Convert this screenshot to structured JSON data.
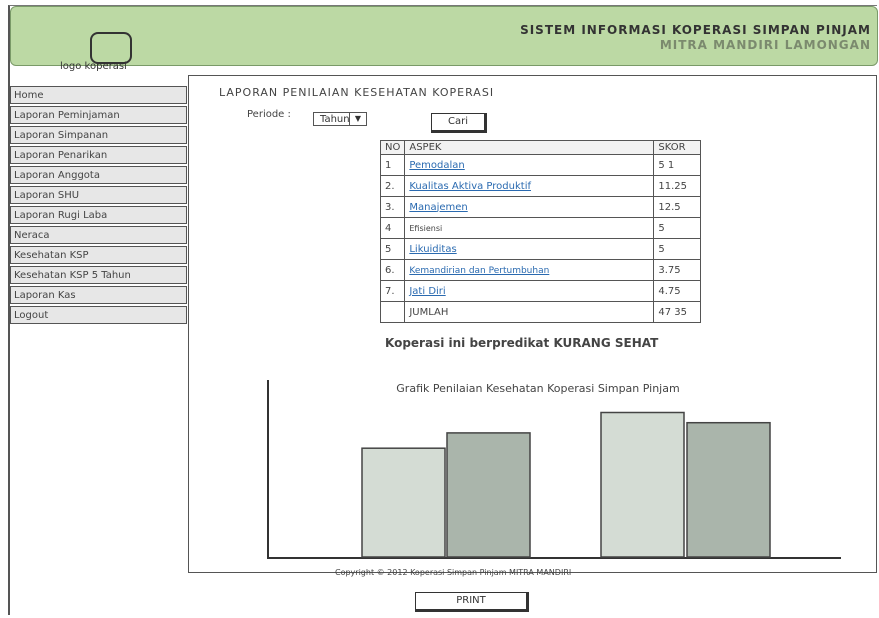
{
  "header": {
    "logo_label": "logo koperasi",
    "title": "SISTEM INFORMASI KOPERASI SIMPAN PINJAM",
    "subtitle": "MITRA MANDIRI LAMONGAN"
  },
  "sidebar": {
    "items": [
      {
        "label": "Home"
      },
      {
        "label": "Laporan Peminjaman"
      },
      {
        "label": "Laporan Simpanan"
      },
      {
        "label": "Laporan Penarikan"
      },
      {
        "label": "Laporan Anggota"
      },
      {
        "label": "Laporan SHU"
      },
      {
        "label": "Laporan Rugi Laba"
      },
      {
        "label": "Neraca"
      },
      {
        "label": "Kesehatan KSP"
      },
      {
        "label": "Kesehatan KSP 5 Tahun"
      },
      {
        "label": "Laporan Kas"
      },
      {
        "label": "Logout"
      }
    ]
  },
  "main": {
    "title": "LAPORAN PENILAIAN KESEHATAN KOPERASI",
    "periode_label": "Periode :",
    "periode_value": "Tahun",
    "cari_label": "Cari",
    "table": {
      "headers": [
        "NO",
        "ASPEK",
        "SKOR"
      ],
      "rows": [
        {
          "no": "1",
          "aspek": "Pemodalan",
          "skor": "5 1",
          "link": true
        },
        {
          "no": "2.",
          "aspek": "Kualitas Aktiva Produktif",
          "skor": "11.25",
          "link": true
        },
        {
          "no": "3.",
          "aspek": "Manajemen",
          "skor": "12.5",
          "link": true
        },
        {
          "no": "4",
          "aspek": "Efisiensi",
          "skor": "5",
          "link": false
        },
        {
          "no": "5",
          "aspek": "Likuiditas",
          "skor": "5",
          "link": true
        },
        {
          "no": "6.",
          "aspek": "Kemandirian dan Pertumbuhan",
          "skor": "3.75",
          "link": true
        },
        {
          "no": "7.",
          "aspek": "Jati Diri",
          "skor": "4.75",
          "link": true
        },
        {
          "no": "",
          "aspek": "JUMLAH",
          "skor": "47 35",
          "link": false
        }
      ]
    },
    "predikat": "Koperasi ini berpredikat KURANG SEHAT"
  },
  "chart_data": {
    "type": "bar",
    "title": "Grafik Penilaian Kesehatan Koperasi Simpan Pinjam",
    "xlabel": "",
    "ylabel": "",
    "series": [
      {
        "values": [
          0.64,
          0.73,
          0.85,
          0.79
        ],
        "color": "#c8d2c9"
      }
    ],
    "bar_colors": [
      "#d4dcd4",
      "#aab5ab",
      "#d4dcd4",
      "#aab5ab"
    ],
    "ylim": [
      0,
      1
    ]
  },
  "footer": {
    "copyright": "Copyright © 2012 Koperasi Simpan Pinjam MITRA MANDIRI",
    "print_label": "PRINT"
  }
}
